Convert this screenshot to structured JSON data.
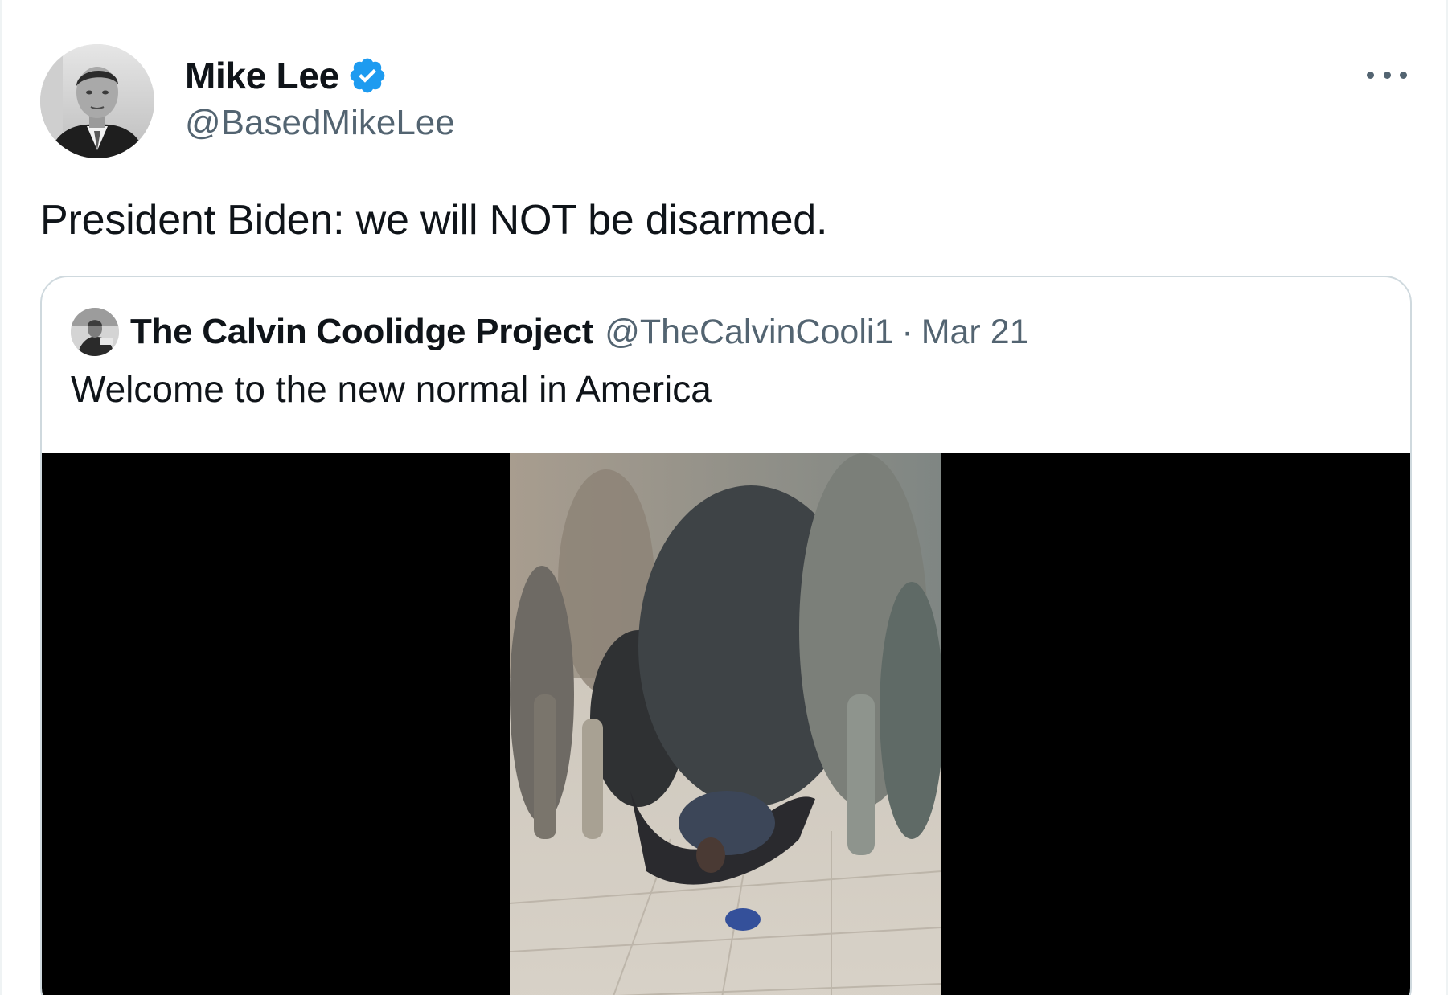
{
  "tweet": {
    "author_name": "Mike Lee",
    "author_handle": "@BasedMikeLee",
    "verified": true,
    "text": "President Biden: we will NOT be disarmed."
  },
  "quote": {
    "author_name": "The Calvin Coolidge Project",
    "author_handle": "@TheCalvinCooli1",
    "separator": "·",
    "date": "Mar 21",
    "text": "Welcome to the new normal in America"
  },
  "icons": {
    "verified": "verified-badge-icon",
    "more": "more-options-icon"
  },
  "colors": {
    "verified_blue": "#1d9bf0",
    "text_primary": "#0f1419",
    "text_secondary": "#536471",
    "border": "#cfd9de"
  }
}
